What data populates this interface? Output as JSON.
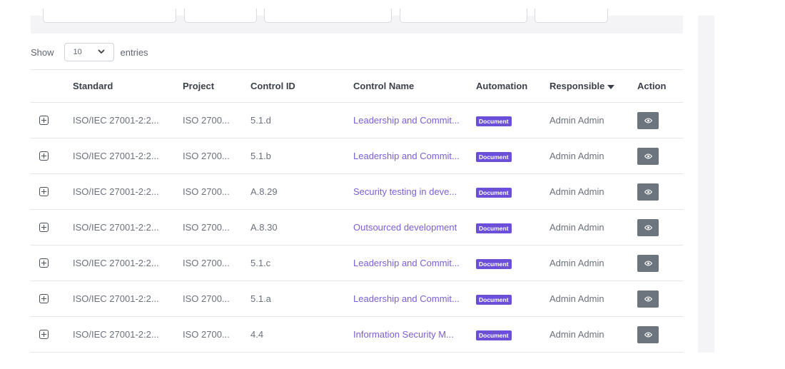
{
  "length_menu": {
    "prefix": "Show",
    "selected": "10",
    "suffix": "entries"
  },
  "table": {
    "columns": [
      "",
      "Standard",
      "Project",
      "Control ID",
      "Control Name",
      "Automation",
      "Responsible",
      "Action"
    ],
    "sorted_column": "Responsible",
    "rows": [
      {
        "standard": "ISO/IEC 27001-2:2...",
        "project": "ISO 2700...",
        "control_id": "5.1.d",
        "control_name": "Leadership and Commit...",
        "automation": "Document",
        "responsible": "Admin Admin"
      },
      {
        "standard": "ISO/IEC 27001-2:2...",
        "project": "ISO 2700...",
        "control_id": "5.1.b",
        "control_name": "Leadership and Commit...",
        "automation": "Document",
        "responsible": "Admin Admin"
      },
      {
        "standard": "ISO/IEC 27001-2:2...",
        "project": "ISO 2700...",
        "control_id": "A.8.29",
        "control_name": "Security testing in deve...",
        "automation": "Document",
        "responsible": "Admin Admin"
      },
      {
        "standard": "ISO/IEC 27001-2:2...",
        "project": "ISO 2700...",
        "control_id": "A.8.30",
        "control_name": "Outsourced development",
        "automation": "Document",
        "responsible": "Admin Admin"
      },
      {
        "standard": "ISO/IEC 27001-2:2...",
        "project": "ISO 2700...",
        "control_id": "5.1.c",
        "control_name": "Leadership and Commit...",
        "automation": "Document",
        "responsible": "Admin Admin"
      },
      {
        "standard": "ISO/IEC 27001-2:2...",
        "project": "ISO 2700...",
        "control_id": "5.1.a",
        "control_name": "Leadership and Commit...",
        "automation": "Document",
        "responsible": "Admin Admin"
      },
      {
        "standard": "ISO/IEC 27001-2:2...",
        "project": "ISO 2700...",
        "control_id": "4.4",
        "control_name": "Information Security M...",
        "automation": "Document",
        "responsible": "Admin Admin"
      }
    ]
  },
  "colors": {
    "link": "#7a5fd6",
    "badge": "#6b4fd8",
    "view_button": "#6c757d"
  },
  "icons": {
    "expand": "plus-square-icon",
    "view": "eye-icon",
    "select": "chevron-down-icon",
    "sort": "caret-down-icon"
  }
}
